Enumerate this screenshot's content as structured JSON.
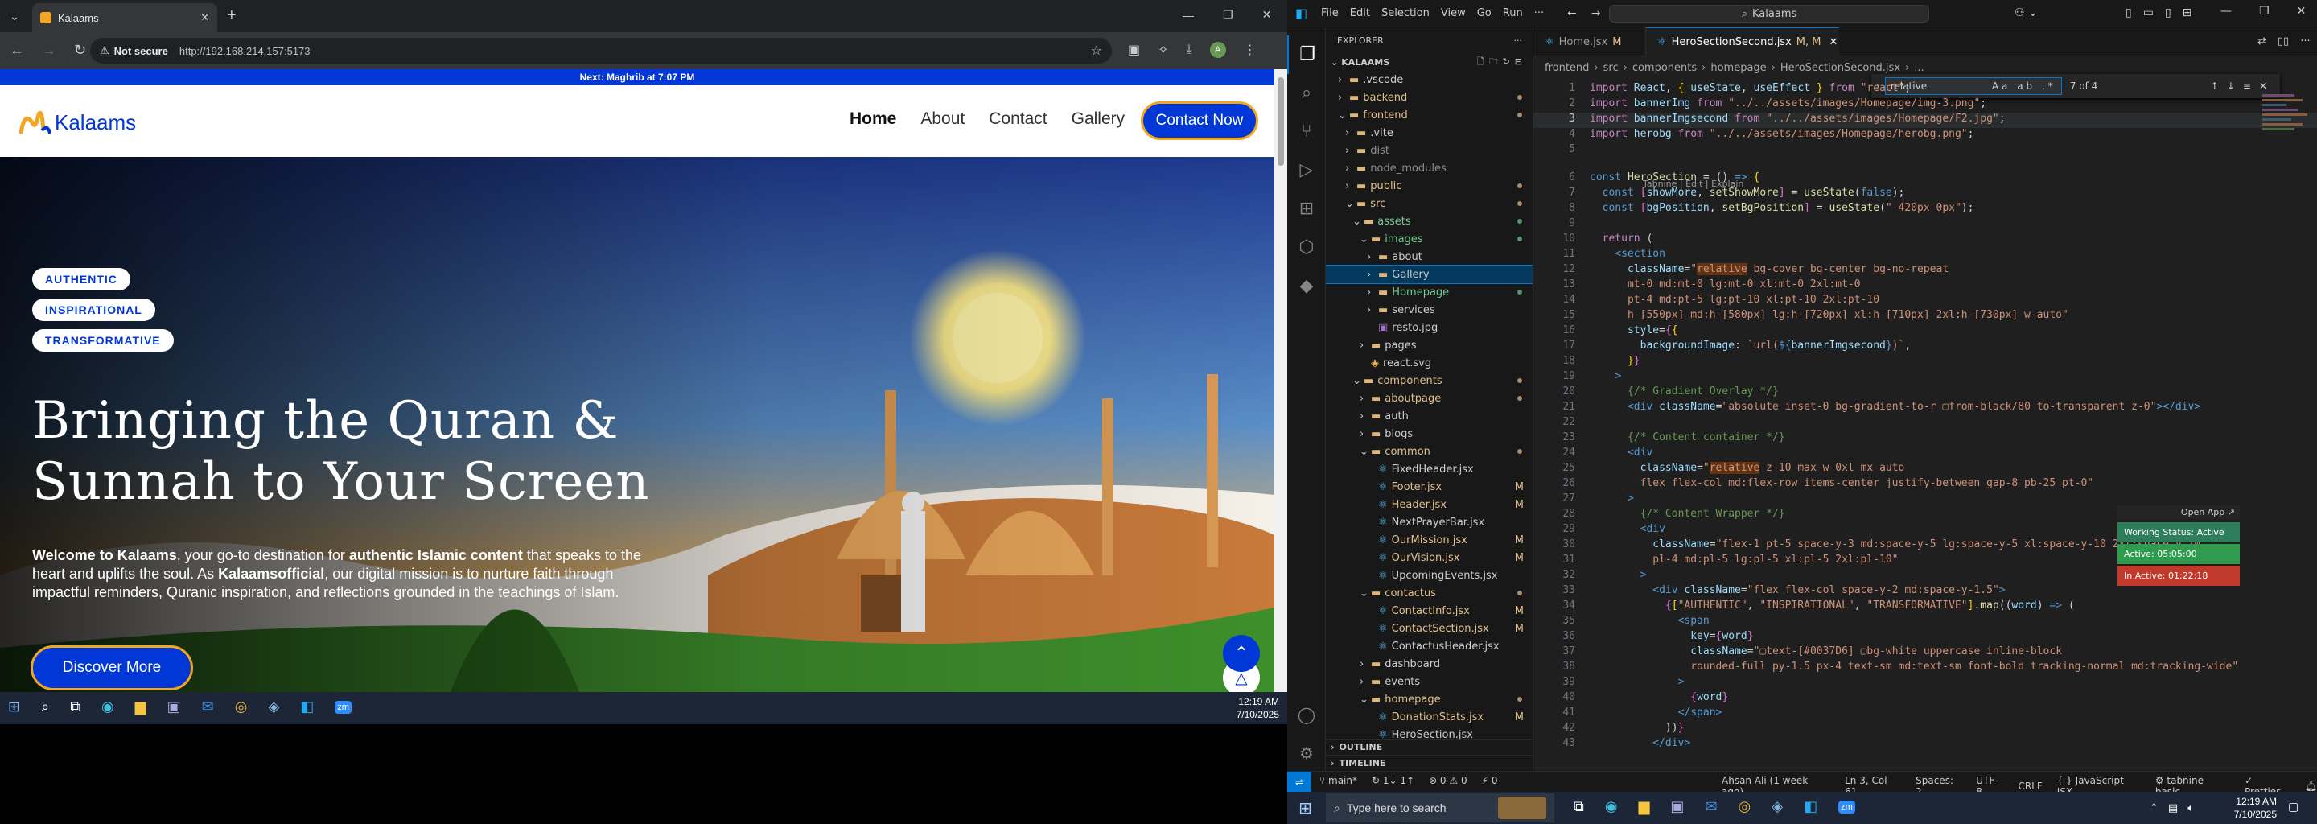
{
  "browser": {
    "tab_title": "Kalaams",
    "address_security": "Not secure",
    "address_url": "http://192.168.214.157:5173",
    "new_tab_symbol": "+",
    "profile_initial": "A"
  },
  "site": {
    "prayer_bar": "Next: Maghrib at 7:07 PM",
    "logo_text": "Kalaams",
    "nav": [
      "Home",
      "About",
      "Contact",
      "Gallery"
    ],
    "contact_button": "Contact Now",
    "badges": [
      "AUTHENTIC",
      "INSPIRATIONAL",
      "TRANSFORMATIVE"
    ],
    "headline_line1": "Bringing the Quran &",
    "headline_line2": "Sunnah to Your Screen",
    "description_p1": "Welcome to Kalaams",
    "description_p2": ", your go-to destination for ",
    "description_p3": "authentic Islamic content",
    "description_p4": " that speaks to the heart and uplifts the soul. As ",
    "description_p5": "Kalaamsofficial",
    "description_p6": ", our digital mission is to nurture faith through impactful reminders, Quranic inspiration, and reflections grounded in the teachings of Islam.",
    "discover_button": "Discover More",
    "colors": {
      "brand": "#0037D6",
      "accent": "#f4a623"
    }
  },
  "win_taskbar_left": {
    "time": "12:19 AM",
    "date": "7/10/2025"
  },
  "vscode": {
    "menu": [
      "File",
      "Edit",
      "Selection",
      "View",
      "Go",
      "Run",
      "···"
    ],
    "command_center": "Kalaams",
    "explorer_title": "EXPLORER",
    "workspace": "KALAAMS",
    "tabs": [
      {
        "label": "Home.jsx",
        "suffix": "M"
      },
      {
        "label": "HeroSectionSecond.jsx",
        "suffix": "M, M"
      }
    ],
    "breadcrumb": [
      "frontend",
      "src",
      "components",
      "homepage",
      "HeroSectionSecond.jsx",
      "..."
    ],
    "find_query": "relative",
    "find_count": "7 of 4",
    "codelens": "Tabnine | Edit | Explain",
    "tree": [
      {
        "label": ".vscode",
        "depth": 1,
        "type": "folder",
        "open": false,
        "color": "#ccc"
      },
      {
        "label": "backend",
        "depth": 1,
        "type": "folder",
        "open": false,
        "color": "#e2c08d"
      },
      {
        "label": "frontend",
        "depth": 1,
        "type": "folder",
        "open": true,
        "color": "#e2c08d"
      },
      {
        "label": ".vite",
        "depth": 2,
        "type": "folder",
        "open": false,
        "color": "#ccc"
      },
      {
        "label": "dist",
        "depth": 2,
        "type": "folder",
        "open": false,
        "color": "#8c8c8c"
      },
      {
        "label": "node_modules",
        "depth": 2,
        "type": "folder",
        "open": false,
        "color": "#8c8c8c"
      },
      {
        "label": "public",
        "depth": 2,
        "type": "folder",
        "open": false,
        "color": "#e2c08d"
      },
      {
        "label": "src",
        "depth": 2,
        "type": "folder",
        "open": true,
        "color": "#e2c08d"
      },
      {
        "label": "assets",
        "depth": 3,
        "type": "folder",
        "open": true,
        "color": "#73c991"
      },
      {
        "label": "images",
        "depth": 4,
        "type": "folder",
        "open": true,
        "color": "#73c991"
      },
      {
        "label": "about",
        "depth": 5,
        "type": "folder",
        "open": false,
        "color": "#ccc"
      },
      {
        "label": "Gallery",
        "depth": 5,
        "type": "folder",
        "open": false,
        "color": "#ccc"
      },
      {
        "label": "Homepage",
        "depth": 5,
        "type": "folder",
        "open": false,
        "color": "#73c991"
      },
      {
        "label": "services",
        "depth": 5,
        "type": "folder",
        "open": false,
        "color": "#ccc"
      },
      {
        "label": "resto.jpg",
        "depth": 5,
        "type": "file",
        "open": false,
        "color": "#ccc"
      },
      {
        "label": "pages",
        "depth": 4,
        "type": "folder",
        "open": false,
        "color": "#ccc"
      },
      {
        "label": "react.svg",
        "depth": 4,
        "type": "file",
        "open": false,
        "color": "#ccc"
      },
      {
        "label": "components",
        "depth": 3,
        "type": "folder",
        "open": true,
        "color": "#e2c08d"
      },
      {
        "label": "aboutpage",
        "depth": 4,
        "type": "folder",
        "open": false,
        "color": "#e2c08d"
      },
      {
        "label": "auth",
        "depth": 4,
        "type": "folder",
        "open": false,
        "color": "#ccc"
      },
      {
        "label": "blogs",
        "depth": 4,
        "type": "folder",
        "open": false,
        "color": "#ccc"
      },
      {
        "label": "common",
        "depth": 4,
        "type": "folder",
        "open": true,
        "color": "#e2c08d"
      },
      {
        "label": "FixedHeader.jsx",
        "depth": 5,
        "type": "file",
        "open": false,
        "color": "#ccc",
        "badge": ""
      },
      {
        "label": "Footer.jsx",
        "depth": 5,
        "type": "file",
        "open": false,
        "color": "#e2c08d",
        "badge": "M"
      },
      {
        "label": "Header.jsx",
        "depth": 5,
        "type": "file",
        "open": false,
        "color": "#e2c08d",
        "badge": "M"
      },
      {
        "label": "NextPrayerBar.jsx",
        "depth": 5,
        "type": "file",
        "open": false,
        "color": "#ccc",
        "badge": ""
      },
      {
        "label": "OurMission.jsx",
        "depth": 5,
        "type": "file",
        "open": false,
        "color": "#e2c08d",
        "badge": "M"
      },
      {
        "label": "OurVision.jsx",
        "depth": 5,
        "type": "file",
        "open": false,
        "color": "#e2c08d",
        "badge": "M"
      },
      {
        "label": "UpcomingEvents.jsx",
        "depth": 5,
        "type": "file",
        "open": false,
        "color": "#ccc",
        "badge": ""
      },
      {
        "label": "contactus",
        "depth": 4,
        "type": "folder",
        "open": true,
        "color": "#e2c08d"
      },
      {
        "label": "ContactInfo.jsx",
        "depth": 5,
        "type": "file",
        "open": false,
        "color": "#e2c08d",
        "badge": "M"
      },
      {
        "label": "ContactSection.jsx",
        "depth": 5,
        "type": "file",
        "open": false,
        "color": "#e2c08d",
        "badge": "M"
      },
      {
        "label": "ContactusHeader.jsx",
        "depth": 5,
        "type": "file",
        "open": false,
        "color": "#ccc",
        "badge": ""
      },
      {
        "label": "dashboard",
        "depth": 4,
        "type": "folder",
        "open": false,
        "color": "#ccc"
      },
      {
        "label": "events",
        "depth": 4,
        "type": "folder",
        "open": false,
        "color": "#ccc"
      },
      {
        "label": "homepage",
        "depth": 4,
        "type": "folder",
        "open": true,
        "color": "#e2c08d"
      },
      {
        "label": "DonationStats.jsx",
        "depth": 5,
        "type": "file",
        "open": false,
        "color": "#e2c08d",
        "badge": "M"
      },
      {
        "label": "HeroSection.jsx",
        "depth": 5,
        "type": "file",
        "open": false,
        "color": "#ccc",
        "badge": ""
      }
    ],
    "outline_label": "OUTLINE",
    "timeline_label": "TIMELINE",
    "code": [
      {
        "n": "1",
        "html": "<span class='kw'>import</span> <span class='va'>React</span>, <span class='pu'>{</span> <span class='va'>useState</span>, <span class='va'>useEffect</span> <span class='pu'>}</span> <span class='kw'>from</span> <span class='st'>\"react\"</span>;"
      },
      {
        "n": "2",
        "html": "<span class='kw'>import</span> <span class='va'>bannerImg</span> <span class='kw'>from</span> <span class='st'>\"../../assets/images/Homepage/img-3.png\"</span>;"
      },
      {
        "n": "3",
        "html": "<span class='kw'>import</span> <span class='va'>bannerImgsecond</span> <span class='kw'>from</span> <span class='st'>\"../../assets/images/Homepage/F2.jpg\"</span>;"
      },
      {
        "n": "4",
        "html": "<span class='kw'>import</span> <span class='va'>herobg</span> <span class='kw'>from</span> <span class='st'>\"../../assets/images/Homepage/herobg.png\"</span>;"
      },
      {
        "n": "5",
        "html": ""
      },
      {
        "n": "6",
        "html": "<span class='tg'>const</span> <span class='fn'>HeroSection</span> = () <span class='tg'>=&gt;</span> <span class='pu'>{</span>"
      },
      {
        "n": "7",
        "html": "  <span class='tg'>const</span> <span class='br'>[</span><span class='va'>showMore</span>, <span class='fn'>setShowMore</span><span class='br'>]</span> = <span class='fn'>useState</span>(<span class='tg'>false</span>);"
      },
      {
        "n": "8",
        "html": "  <span class='tg'>const</span> <span class='br'>[</span><span class='va'>bgPosition</span>, <span class='fn'>setBgPosition</span><span class='br'>]</span> = <span class='fn'>useState</span>(<span class='st'>\"-420px 0px\"</span>);"
      },
      {
        "n": "9",
        "html": ""
      },
      {
        "n": "10",
        "html": "  <span class='kw'>return</span> ("
      },
      {
        "n": "11",
        "html": "    <span class='tg'>&lt;section</span>"
      },
      {
        "n": "12",
        "html": "      <span class='va'>className</span>=<span class='st'>\"relative bg-cover bg-center bg-no-repeat</span>"
      },
      {
        "n": "13",
        "html": "<span class='st'>      mt-0 md:mt-0 lg:mt-0 xl:mt-0 2xl:mt-0</span>"
      },
      {
        "n": "14",
        "html": "<span class='st'>      pt-4 md:pt-5 lg:pt-10 xl:pt-10 2xl:pt-10</span>"
      },
      {
        "n": "15",
        "html": "<span class='st'>      h-[550px] md:h-[580px] lg:h-[720px] xl:h-[710px] 2xl:h-[730px] w-auto\"</span>"
      },
      {
        "n": "16",
        "html": "      <span class='va'>style</span>=<span class='br'>{</span><span class='pu'>{</span>"
      },
      {
        "n": "17",
        "html": "        <span class='va'>backgroundImage</span>: <span class='st'>`url(</span><span class='tg'>${</span><span class='va'>bannerImgsecond</span><span class='tg'>}</span><span class='st'>)`</span>,"
      },
      {
        "n": "18",
        "html": "      <span class='pu'>}</span><span class='br'>}</span>"
      },
      {
        "n": "19",
        "html": "    <span class='tg'>&gt;</span>"
      },
      {
        "n": "20",
        "html": "      <span class='cm'>{/* Gradient Overlay */}</span>"
      },
      {
        "n": "21",
        "html": "      <span class='tg'>&lt;div</span> <span class='va'>className</span>=<span class='st'>\"absolute inset-0 bg-gradient-to-r ▢from-black/80 to-transparent z-0\"</span><span class='tg'>&gt;&lt;/div&gt;</span>"
      },
      {
        "n": "22",
        "html": ""
      },
      {
        "n": "23",
        "html": "      <span class='cm'>{/* Content container */}</span>"
      },
      {
        "n": "24",
        "html": "      <span class='tg'>&lt;div</span>"
      },
      {
        "n": "25",
        "html": "        <span class='va'>className</span>=<span class='st'>\"relative z-10 max-w-0xl mx-auto</span>"
      },
      {
        "n": "26",
        "html": "<span class='st'>        flex flex-col md:flex-row items-center justify-between gap-8 pb-25 pt-0\"</span>"
      },
      {
        "n": "27",
        "html": "      <span class='tg'>&gt;</span>"
      },
      {
        "n": "28",
        "html": "        <span class='cm'>{/* Content Wrapper */}</span>"
      },
      {
        "n": "29",
        "html": "        <span class='tg'>&lt;div</span>"
      },
      {
        "n": "30",
        "html": "          <span class='va'>className</span>=<span class='st'>\"flex-1 pt-5 space-y-3 md:space-y-5 lg:space-y-5 xl:space-y-10 2xl:space-y-10</span>"
      },
      {
        "n": "31",
        "html": "<span class='st'>          pl-4 md:pl-5 lg:pl-5 xl:pl-5 2xl:pl-10\"</span>"
      },
      {
        "n": "32",
        "html": "        <span class='tg'>&gt;</span>"
      },
      {
        "n": "33",
        "html": "          <span class='tg'>&lt;div</span> <span class='va'>className</span>=<span class='st'>\"flex flex-col space-y-2 md:space-y-1.5\"</span><span class='tg'>&gt;</span>"
      },
      {
        "n": "34",
        "html": "            <span class='br'>{</span><span class='pu'>[</span><span class='st'>\"AUTHENTIC\"</span>, <span class='st'>\"INSPIRATIONAL\"</span>, <span class='st'>\"TRANSFORMATIVE\"</span><span class='pu'>]</span>.<span class='fn'>map</span>((<span class='va'>word</span>) <span class='tg'>=&gt;</span> ("
      },
      {
        "n": "35",
        "html": "              <span class='tg'>&lt;span</span>"
      },
      {
        "n": "36",
        "html": "                <span class='va'>key</span>=<span class='br'>{</span><span class='va'>word</span><span class='br'>}</span>"
      },
      {
        "n": "37",
        "html": "                <span class='va'>className</span>=<span class='st'>\"▢text-[#0037D6] ▢bg-white uppercase inline-block</span>"
      },
      {
        "n": "38",
        "html": "<span class='st'>                rounded-full py-1.5 px-4 text-sm md:text-sm font-bold tracking-normal md:tracking-wide\"</span>"
      },
      {
        "n": "39",
        "html": "              <span class='tg'>&gt;</span>"
      },
      {
        "n": "40",
        "html": "                <span class='br'>{</span><span class='va'>word</span><span class='br'>}</span>"
      },
      {
        "n": "41",
        "html": "              <span class='tg'>&lt;/span&gt;</span>"
      },
      {
        "n": "42",
        "html": "            ))<span class='br'>}</span>"
      },
      {
        "n": "43",
        "html": "          <span class='tg'>&lt;/div&gt;</span>"
      }
    ],
    "popup": {
      "open_app": "Open App ↗",
      "working": "Working Status: Active",
      "active": "Active: 05:05:00",
      "inactive": "In Active: 01:22:18"
    },
    "status": {
      "branch": "main*",
      "sync": "↻ 1↓ 1↑",
      "problems": "⊗ 0 ⚠ 0",
      "ports": "⚡ 0",
      "blame": "Ahsan Ali (1 week ago)",
      "cursor": "Ln 3, Col 61",
      "spaces": "Spaces: 2",
      "encoding": "UTF-8",
      "eol": "CRLF",
      "lang": "{ } JavaScript JSX",
      "tabnine": "⚙ tabnine basic",
      "prettier": "✓ Prettier"
    }
  },
  "win_taskbar_right": {
    "search": "Type here to search",
    "time": "12:19 AM",
    "date": "7/10/2025"
  }
}
